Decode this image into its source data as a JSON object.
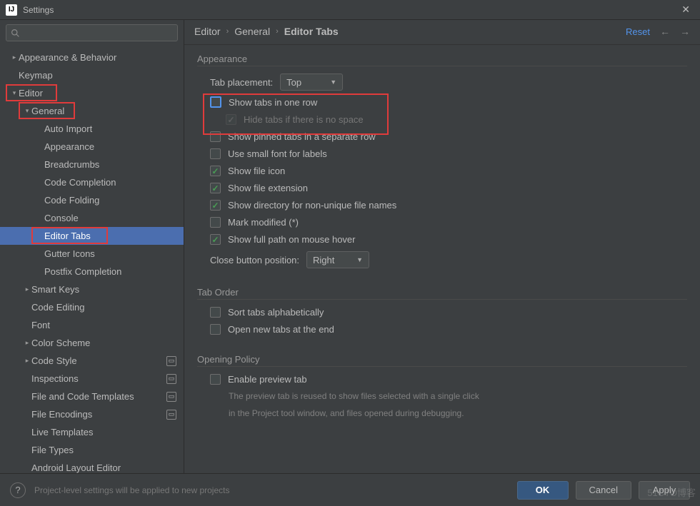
{
  "window": {
    "title": "Settings",
    "app_icon": "IJ"
  },
  "sidebar": {
    "search_placeholder": "",
    "items": [
      {
        "label": "Appearance & Behavior",
        "level": 0,
        "arrow": "closed"
      },
      {
        "label": "Keymap",
        "level": 0,
        "arrow": ""
      },
      {
        "label": "Editor",
        "level": 0,
        "arrow": "open",
        "redbox": true
      },
      {
        "label": "General",
        "level": 1,
        "arrow": "open",
        "redbox": true
      },
      {
        "label": "Auto Import",
        "level": 2,
        "arrow": ""
      },
      {
        "label": "Appearance",
        "level": 2,
        "arrow": ""
      },
      {
        "label": "Breadcrumbs",
        "level": 2,
        "arrow": ""
      },
      {
        "label": "Code Completion",
        "level": 2,
        "arrow": ""
      },
      {
        "label": "Code Folding",
        "level": 2,
        "arrow": ""
      },
      {
        "label": "Console",
        "level": 2,
        "arrow": ""
      },
      {
        "label": "Editor Tabs",
        "level": 2,
        "arrow": "",
        "selected": true,
        "redbox": true
      },
      {
        "label": "Gutter Icons",
        "level": 2,
        "arrow": ""
      },
      {
        "label": "Postfix Completion",
        "level": 2,
        "arrow": ""
      },
      {
        "label": "Smart Keys",
        "level": 1,
        "arrow": "closed"
      },
      {
        "label": "Code Editing",
        "level": 1,
        "arrow": ""
      },
      {
        "label": "Font",
        "level": 1,
        "arrow": ""
      },
      {
        "label": "Color Scheme",
        "level": 1,
        "arrow": "closed"
      },
      {
        "label": "Code Style",
        "level": 1,
        "arrow": "closed",
        "badge": true
      },
      {
        "label": "Inspections",
        "level": 1,
        "arrow": "",
        "badge": true
      },
      {
        "label": "File and Code Templates",
        "level": 1,
        "arrow": "",
        "badge": true
      },
      {
        "label": "File Encodings",
        "level": 1,
        "arrow": "",
        "badge": true
      },
      {
        "label": "Live Templates",
        "level": 1,
        "arrow": ""
      },
      {
        "label": "File Types",
        "level": 1,
        "arrow": ""
      },
      {
        "label": "Android Layout Editor",
        "level": 1,
        "arrow": ""
      }
    ]
  },
  "breadcrumb": {
    "a": "Editor",
    "b": "General",
    "c": "Editor Tabs",
    "reset": "Reset"
  },
  "appearance": {
    "title": "Appearance",
    "tab_placement_label": "Tab placement:",
    "tab_placement_value": "Top",
    "show_one_row": "Show tabs in one row",
    "hide_if_no_space": "Hide tabs if there is no space",
    "show_pinned": "Show pinned tabs in a separate row",
    "small_font": "Use small font for labels",
    "file_icon": "Show file icon",
    "file_ext": "Show file extension",
    "dir_non_unique": "Show directory for non-unique file names",
    "mark_modified": "Mark modified (*)",
    "full_path_hover": "Show full path on mouse hover",
    "close_btn_label": "Close button position:",
    "close_btn_value": "Right"
  },
  "tab_order": {
    "title": "Tab Order",
    "sort_alpha": "Sort tabs alphabetically",
    "open_end": "Open new tabs at the end"
  },
  "opening": {
    "title": "Opening Policy",
    "enable_preview": "Enable preview tab",
    "desc1": "The preview tab is reused to show files selected with a single click",
    "desc2": "in the Project tool window, and files opened during debugging."
  },
  "footer": {
    "hint": "Project-level settings will be applied to new projects",
    "ok": "OK",
    "cancel": "Cancel",
    "apply": "Apply"
  },
  "watermark": "51CTO博客"
}
